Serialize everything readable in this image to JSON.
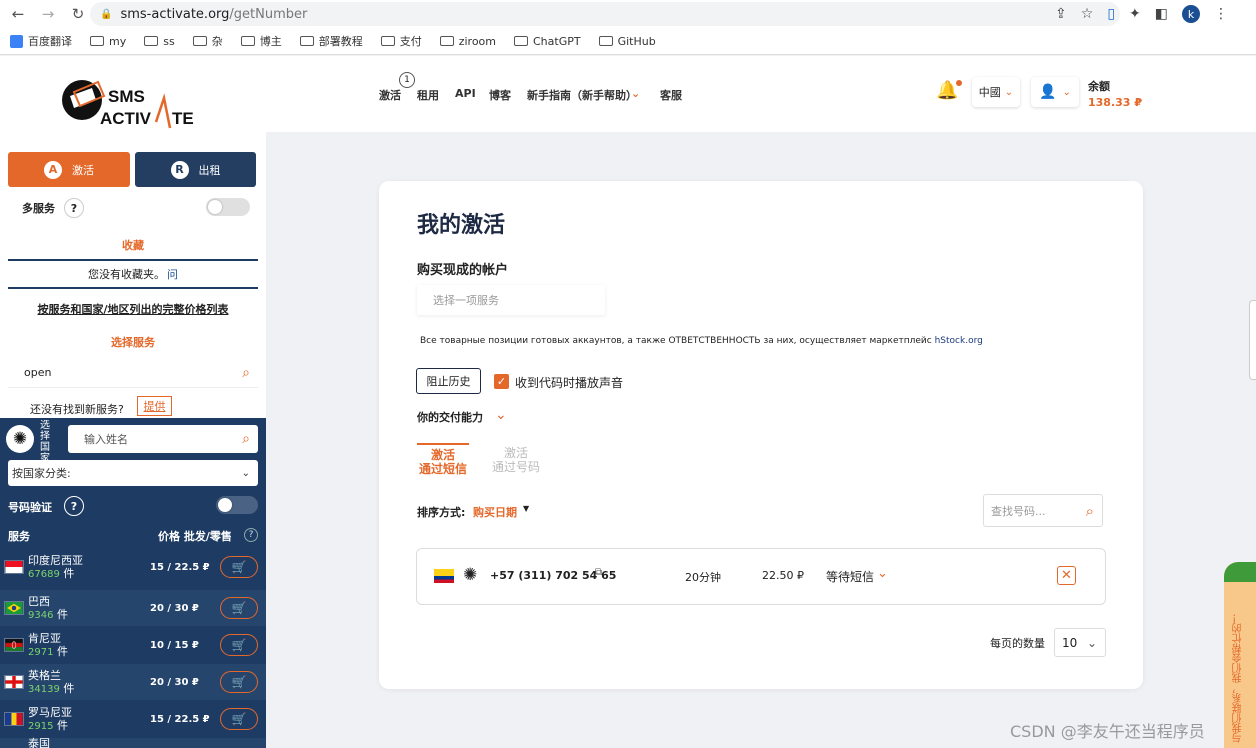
{
  "browser": {
    "url_host": "sms-activate.org",
    "url_path": "/getNumber",
    "avatar_letter": "k",
    "bookmarks": [
      {
        "label": "百度翻译",
        "icon": "baidu-translate-icon"
      },
      {
        "label": "my",
        "icon": "folder-icon"
      },
      {
        "label": "ss",
        "icon": "folder-icon"
      },
      {
        "label": "杂",
        "icon": "folder-icon"
      },
      {
        "label": "博主",
        "icon": "folder-icon"
      },
      {
        "label": "部署教程",
        "icon": "folder-icon"
      },
      {
        "label": "支付",
        "icon": "folder-icon"
      },
      {
        "label": "ziroom",
        "icon": "folder-icon"
      },
      {
        "label": "ChatGPT",
        "icon": "folder-icon"
      },
      {
        "label": "GitHub",
        "icon": "folder-icon"
      }
    ]
  },
  "colors": {
    "accent": "#e4682a",
    "navy": "#1e3c63",
    "count_green": "#7bd36e"
  },
  "sidebar": {
    "tab_activate": "激活",
    "tab_rent": "出租",
    "multi_service_label": "多服务",
    "help_mark": "?",
    "favorites_title": "收藏",
    "no_favorites_text": "您没有收藏夹。",
    "no_favorites_link": "问",
    "price_list_link": "按服务和国家/地区列出的完整价格列表",
    "select_service_title": "选择服务",
    "service_search_value": "open",
    "not_found_text": "还没有找到新服务?",
    "suggest_button": "提供",
    "select_country_label": "选择国家",
    "country_search_placeholder": "输入姓名",
    "country_category_select": "按国家分类:",
    "number_verify_label": "号码验证",
    "col_service": "服务",
    "col_price": "价格 批发/零售",
    "countries": [
      {
        "name": "印度尼西亚",
        "count": "67689",
        "unit": "件",
        "price": "15 / 22.5 ₽",
        "flag": "indonesia"
      },
      {
        "name": "巴西",
        "count": "9346",
        "unit": "件",
        "price": "20 / 30 ₽",
        "flag": "brazil"
      },
      {
        "name": "肯尼亚",
        "count": "2971",
        "unit": "件",
        "price": "10 / 15 ₽",
        "flag": "kenya"
      },
      {
        "name": "英格兰",
        "count": "34139",
        "unit": "件",
        "price": "20 / 30 ₽",
        "flag": "england"
      },
      {
        "name": "罗马尼亚",
        "count": "2915",
        "unit": "件",
        "price": "15 / 22.5 ₽",
        "flag": "romania"
      },
      {
        "name": "泰国",
        "count": "",
        "unit": "",
        "price": "",
        "flag": "thailand"
      }
    ]
  },
  "header": {
    "nav": [
      "激活",
      "租用",
      "API",
      "博客",
      "新手指南（新手帮助）",
      "客服"
    ],
    "nav_badge": "1",
    "language": "中國",
    "balance_label": "余额",
    "balance_value": "138.33 ₽"
  },
  "main": {
    "title": "我的激活",
    "buy_accounts_title": "购买现成的帐户",
    "service_select_placeholder": "选择一项服务",
    "notice_text": "Все товарные позиции готовых аккаунтов, а также ОТВЕТСТВЕННОСТЬ за них, осуществляет маркетплейс",
    "notice_link": "hStock.org",
    "block_history_button": "阻止历史",
    "sound_checkbox_label": "收到代码时播放声音",
    "sound_checkbox_checked": true,
    "payment_ability": "你的交付能力",
    "tab_sms": "激活\n通过短信",
    "tab_number": "激活\n通过号码",
    "sort_label": "排序方式:",
    "sort_value": "购买日期",
    "number_search_placeholder": "查找号码...",
    "activation": {
      "country_flag": "colombia",
      "service_icon": "openai-icon",
      "phone": "+57 (311) 702 54 65",
      "time_left": "20分钟",
      "price": "22.50 ₽",
      "status": "等待短信"
    },
    "per_page_label": "每页的数量",
    "per_page_value": "10"
  },
  "feedback_tab": "与我们联系，我们会帮忙的！",
  "watermark": "CSDN @李友午还当程序员"
}
